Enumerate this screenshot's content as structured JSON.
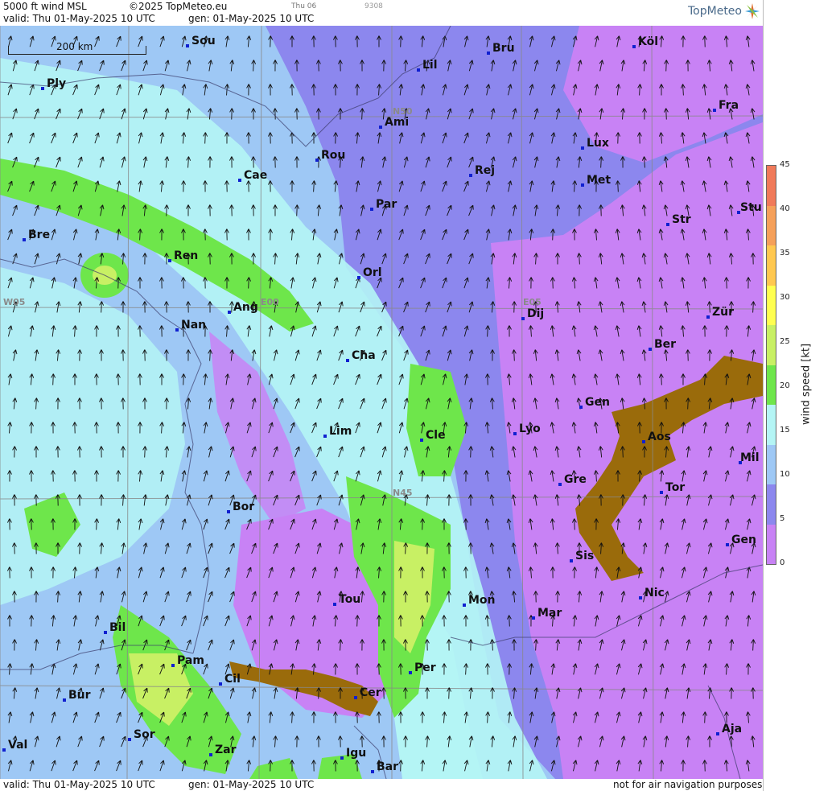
{
  "header": {
    "product": "5000 ft wind MSL",
    "copyright": "©2025 TopMeteo.eu",
    "day": "Thu 06",
    "code": "9308",
    "valid": "valid:  Thu  01-May-2025  10 UTC",
    "gen": "gen: 01-May-2025 10 UTC",
    "logo": "TopMeteo"
  },
  "footer": {
    "valid": "valid:  Thu  01-May-2025  10 UTC",
    "gen": "gen: 01-May-2025 10 UTC",
    "disclaimer": "not for air navigation purposes"
  },
  "scale_bar": "200 km",
  "grid_labels": [
    "N50",
    "N45",
    "W05",
    "E00",
    "E05"
  ],
  "cities": [
    "Sou",
    "Bru",
    "Köl",
    "Lil",
    "Ply",
    "Ami",
    "Fra",
    "Lux",
    "Rou",
    "Cae",
    "Rej",
    "Met",
    "Par",
    "Stu",
    "Bre",
    "Str",
    "Ren",
    "Orl",
    "Ang",
    "Dij",
    "Zür",
    "Nan",
    "Ber",
    "Cha",
    "Gen",
    "Lim",
    "Cle",
    "Lyo",
    "Aos",
    "Mil",
    "Gre",
    "Tor",
    "Bor",
    "Gen",
    "Sis",
    "Nic",
    "Tou",
    "Mon",
    "Mar",
    "Bil",
    "Pam",
    "Cil",
    "Per",
    "Cer",
    "Bur",
    "Sor",
    "Aja",
    "Val",
    "Zar",
    "Igu",
    "Bar"
  ],
  "colorbar": {
    "title": "wind speed [kt]",
    "ticks": [
      "45",
      "40",
      "35",
      "30",
      "25",
      "20",
      "15",
      "10",
      "5",
      "0"
    ],
    "colors": [
      "#f07a5a",
      "#f5a05a",
      "#ffc850",
      "#ffff50",
      "#c8f064",
      "#6ee64b",
      "#b4f5f5",
      "#9ec8f5",
      "#8c87ee",
      "#c882f5"
    ]
  }
}
